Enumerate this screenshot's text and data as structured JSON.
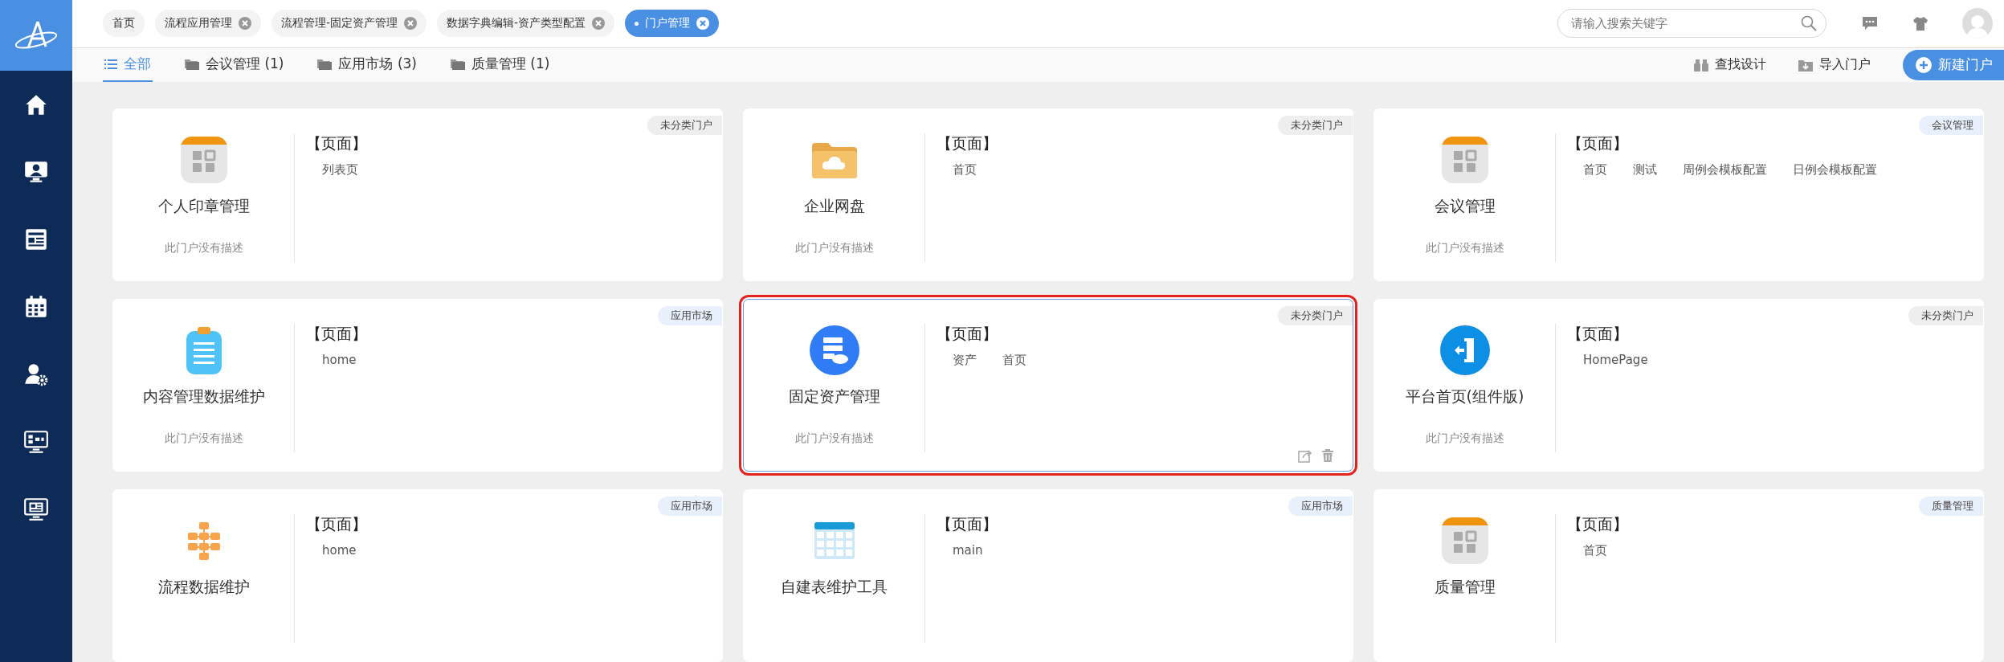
{
  "sidebar": {
    "items": [
      {
        "kind": "home"
      },
      {
        "kind": "monitor-person"
      },
      {
        "kind": "news"
      },
      {
        "kind": "calendar"
      },
      {
        "kind": "user-gear"
      },
      {
        "kind": "monitor-diagram"
      },
      {
        "kind": "monitor-doc"
      }
    ]
  },
  "open_tabs": [
    {
      "label": "首页",
      "selected": false,
      "closable": false
    },
    {
      "label": "流程应用管理",
      "selected": false,
      "closable": true
    },
    {
      "label": "流程管理-固定资产管理",
      "selected": false,
      "closable": true
    },
    {
      "label": "数据字典编辑-资产类型配置",
      "selected": false,
      "closable": true
    },
    {
      "label": "门户管理",
      "selected": true,
      "closable": true
    }
  ],
  "search": {
    "placeholder": "请输入搜索关键字"
  },
  "filter_tabs": [
    {
      "label": "全部",
      "selected": true,
      "kind": "list"
    },
    {
      "label": "会议管理 (1)",
      "selected": false,
      "kind": "folder"
    },
    {
      "label": "应用市场 (3)",
      "selected": false,
      "kind": "folder"
    },
    {
      "label": "质量管理 (1)",
      "selected": false,
      "kind": "folder"
    }
  ],
  "actions": [
    {
      "label": "查找设计",
      "kind": "binoculars"
    },
    {
      "label": "导入门户",
      "kind": "import"
    },
    {
      "label": "新建门户",
      "kind": "primary"
    }
  ],
  "portals": [
    {
      "name": "个人印章管理",
      "description": "此门户没有描述",
      "category": "未分类门户",
      "color": "#eeeeee",
      "kind": "tile",
      "section_label": "【页面】",
      "pages": [
        "列表页"
      ],
      "selected": false
    },
    {
      "name": "企业网盘",
      "description": "此门户没有描述",
      "category": "未分类门户",
      "color": "#eeeeee",
      "kind": "folder",
      "section_label": "【页面】",
      "pages": [
        "首页"
      ],
      "selected": false
    },
    {
      "name": "会议管理",
      "description": "此门户没有描述",
      "category": "会议管理",
      "color": "#e8f0fb",
      "kind": "tile",
      "section_label": "【页面】",
      "pages": [
        "首页",
        "测试",
        "周例会模板配置",
        "日例会模板配置"
      ],
      "selected": false
    },
    {
      "name": "内容管理数据维护",
      "description": "此门户没有描述",
      "category": "应用市场",
      "color": "#e8f0fb",
      "kind": "clipboard",
      "section_label": "【页面】",
      "pages": [
        "home"
      ],
      "selected": false
    },
    {
      "name": "固定资产管理",
      "description": "此门户没有描述",
      "category": "未分类门户",
      "color": "#eeeeee",
      "kind": "server",
      "section_label": "【页面】",
      "pages": [
        "资产",
        "首页"
      ],
      "selected": true
    },
    {
      "name": "平台首页(组件版)",
      "description": "此门户没有描述",
      "category": "未分类门户",
      "color": "#eeeeee",
      "kind": "door",
      "section_label": "【页面】",
      "pages": [
        "HomePage"
      ],
      "selected": false
    },
    {
      "name": "流程数据维护",
      "category": "应用市场",
      "color": "#e8f0fb",
      "kind": "flowchart",
      "section_label": "【页面】",
      "pages": [
        "home"
      ],
      "selected": false
    },
    {
      "name": "自建表维护工具",
      "category": "应用市场",
      "color": "#e8f0fb",
      "kind": "table",
      "section_label": "【页面】",
      "pages": [
        "main"
      ],
      "selected": false
    },
    {
      "name": "质量管理",
      "category": "质量管理",
      "color": "#e8f0fb",
      "kind": "tile",
      "section_label": "【页面】",
      "pages": [
        "首页"
      ],
      "selected": false
    }
  ]
}
